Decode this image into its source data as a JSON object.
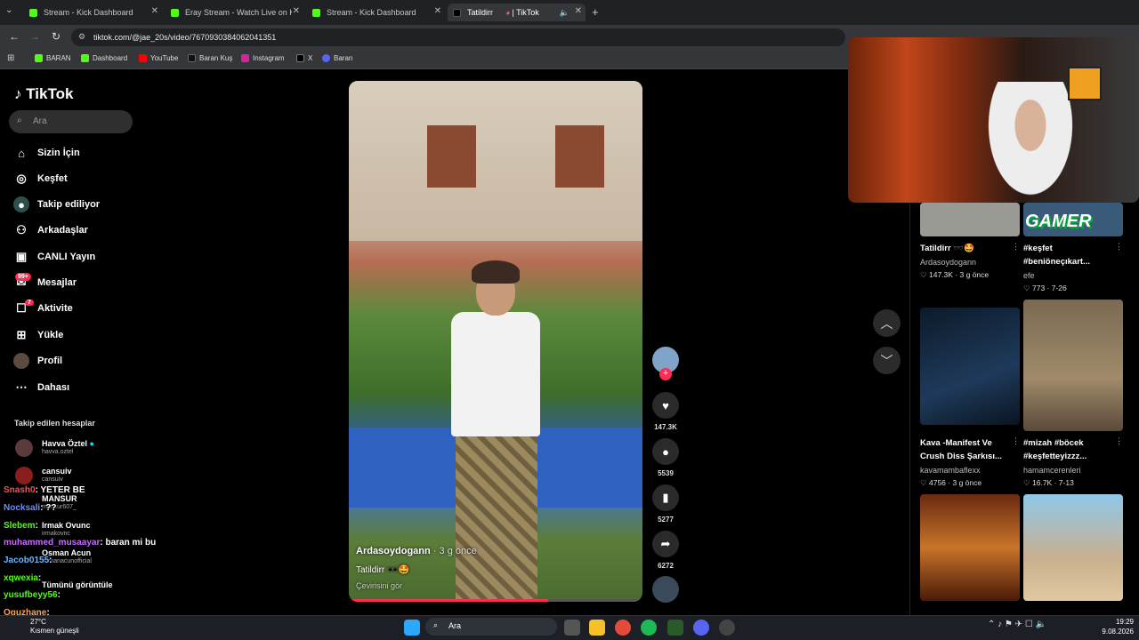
{
  "tabs": [
    {
      "label": "Stream - Kick Dashboard"
    },
    {
      "label": "Eray Stream - Watch Live on Kick"
    },
    {
      "label": "Stream - Kick Dashboard"
    },
    {
      "label": "Tatildirr",
      "label2": "| TikTok"
    }
  ],
  "address": {
    "url": "tiktok.com/@jae_20s/video/7670930384062041351"
  },
  "bookmarks": [
    "BARAN",
    "Dashboard",
    "YouTube",
    "Baran Kuş",
    "Instagram",
    "X",
    "Baran"
  ],
  "sidebar": {
    "logo": "TikTok",
    "search_placeholder": "Ara",
    "items": [
      {
        "label": "Sizin İçin",
        "icon": "home-icon"
      },
      {
        "label": "Keşfet",
        "icon": "compass-icon"
      },
      {
        "label": "Takip ediliyor",
        "icon": "following-icon"
      },
      {
        "label": "Arkadaşlar",
        "icon": "friends-icon"
      },
      {
        "label": "CANLI Yayın",
        "icon": "live-icon"
      },
      {
        "label": "Mesajlar",
        "icon": "message-icon",
        "badge": "99+"
      },
      {
        "label": "Aktivite",
        "icon": "activity-icon",
        "badge": "7"
      },
      {
        "label": "Yükle",
        "icon": "upload-icon"
      },
      {
        "label": "Profil",
        "icon": "profile-icon"
      },
      {
        "label": "Dahası",
        "icon": "more-icon"
      }
    ],
    "following_title": "Takip edilen hesaplar",
    "following": [
      {
        "name": "Havva Öztel",
        "handle": "havva.oztel"
      },
      {
        "name": "cansuiv",
        "handle": "cansuiv"
      },
      {
        "name": "MANSUR",
        "handle": "mansur607_"
      },
      {
        "name": "Irmak Ovunc",
        "handle": "irmakovnc"
      },
      {
        "name": "Osman Acun",
        "handle": "osmanacunofficial"
      }
    ],
    "see_all": "Tümünü görüntüle"
  },
  "chat": [
    {
      "user": "Snash0",
      "msg": ": YETER BE",
      "color": "#ff4d4d"
    },
    {
      "user": "Nocksali",
      "msg": ": ??",
      "color": "#6b8cff"
    },
    {
      "user": "Slebem",
      "msg": ":",
      "color": "#53fc18"
    },
    {
      "user": "muhammed_musaayar",
      "msg": ": baran mi bu",
      "color": "#c86bff"
    },
    {
      "user": "Jacob0155",
      "msg": ":",
      "color": "#6bb6ff"
    },
    {
      "user": "xqwexia",
      "msg": ":",
      "color": "#53fc18"
    },
    {
      "user": "yusufbeyy56",
      "msg": ":",
      "color": "#53fc18"
    },
    {
      "user": "Oguzhane",
      "msg": ":",
      "color": "#ffa64d"
    }
  ],
  "video": {
    "author": "Ardasoydogann",
    "time": "· 3 g önce",
    "caption": "Tatildirr 🕶️🤩",
    "translate": "Çevirisini gör"
  },
  "actions": {
    "likes": "147.3K",
    "comments": "5539",
    "saves": "5277",
    "shares": "6272"
  },
  "right_panel": {
    "cards": [
      {
        "title": "Tatildirr 🕶️🤩",
        "author": "Ardasoydogann",
        "likes": "147.3K",
        "date": "3 g önce"
      },
      {
        "title": "#keşfet #beniöneçıkart...",
        "author": "efe",
        "likes": "773",
        "date": "7-26"
      },
      {
        "title": "Kava -Manifest Ve Crush Diss Şarkısı...",
        "author": "kavamambaflexx",
        "likes": "4756",
        "date": "3 g önce"
      },
      {
        "title": "#mizah #böcek #keşfetteyizzz...",
        "author": "hamamcerenleri",
        "likes": "16.7K",
        "date": "7-13"
      }
    ],
    "overlay": "GAMER"
  },
  "taskbar": {
    "weather_temp": "27°C",
    "weather_text": "Kısmen güneşli",
    "search": "Ara",
    "time": "19:29",
    "date": "9.08.2026"
  }
}
